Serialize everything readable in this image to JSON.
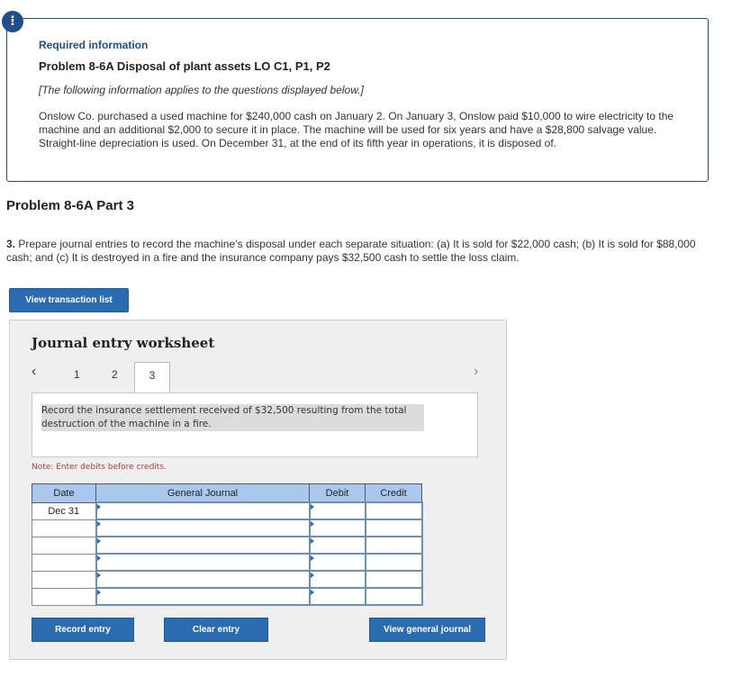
{
  "alert": {
    "icon": "!"
  },
  "info": {
    "required_label": "Required information",
    "problem_title": "Problem 8-6A Disposal of plant assets LO C1, P1, P2",
    "note": "[The following information applies to the questions displayed below.]",
    "body": "Onslow Co. purchased a used machine for $240,000 cash on January 2. On January 3, Onslow paid $10,000 to wire electricity to the machine and an additional $2,000 to secure it in place. The machine will be used for six years and have a $28,800 salvage value. Straight-line depreciation is used. On December 31, at the end of its fifth year in operations, it is disposed of."
  },
  "part_title": "Problem 8-6A Part 3",
  "question": {
    "number": "3.",
    "text": "Prepare journal entries to record the machine’s disposal under each separate situation: (a) It is sold for $22,000 cash; (b) It is sold for $88,000 cash; and (c) It is destroyed in a fire and the insurance company pays $32,500 cash to settle the loss claim."
  },
  "buttons": {
    "view_transaction_list": "View transaction list",
    "record_entry": "Record entry",
    "clear_entry": "Clear entry",
    "view_general_journal": "View general journal"
  },
  "worksheet": {
    "title": "Journal entry worksheet",
    "prev_icon": "‹",
    "next_icon": "›",
    "tabs": [
      "1",
      "2",
      "3"
    ],
    "active_tab": "3",
    "instruction": "Record the insurance settlement received of $32,500 resulting from the total destruction of the machine in a fire.",
    "note": "Note: Enter debits before credits."
  },
  "journal": {
    "headers": {
      "date": "Date",
      "account": "General Journal",
      "debit": "Debit",
      "credit": "Credit"
    },
    "rows": [
      {
        "date": "Dec 31",
        "account": "",
        "debit": "",
        "credit": ""
      },
      {
        "date": "",
        "account": "",
        "debit": "",
        "credit": ""
      },
      {
        "date": "",
        "account": "",
        "debit": "",
        "credit": ""
      },
      {
        "date": "",
        "account": "",
        "debit": "",
        "credit": ""
      },
      {
        "date": "",
        "account": "",
        "debit": "",
        "credit": ""
      },
      {
        "date": "",
        "account": "",
        "debit": "",
        "credit": ""
      }
    ]
  },
  "colors": {
    "accent": "#2b6cb0",
    "header_bg": "#aac8ee",
    "note_red": "#b23b3b"
  }
}
